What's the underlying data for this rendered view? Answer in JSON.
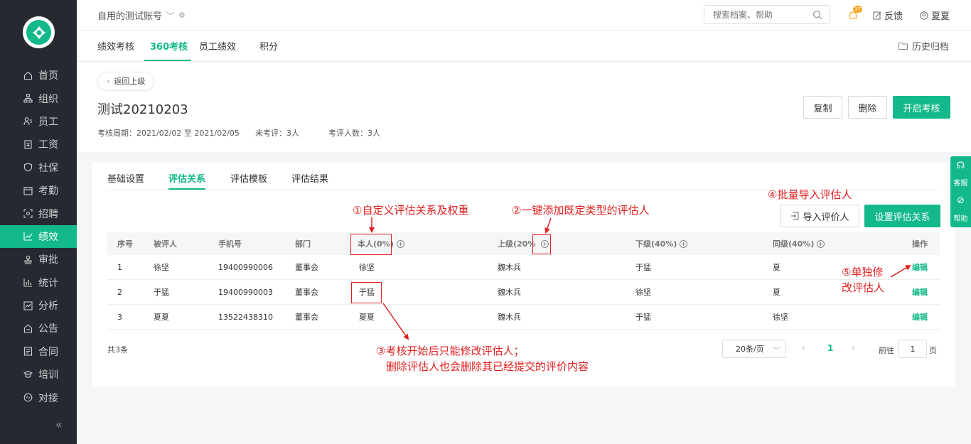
{
  "sidebar": {
    "items": [
      {
        "label": "首页",
        "icon": "home-icon"
      },
      {
        "label": "组织",
        "icon": "org-icon"
      },
      {
        "label": "员工",
        "icon": "employee-icon"
      },
      {
        "label": "工资",
        "icon": "salary-icon"
      },
      {
        "label": "社保",
        "icon": "shield-icon"
      },
      {
        "label": "考勤",
        "icon": "calendar-icon"
      },
      {
        "label": "招聘",
        "icon": "recruit-icon"
      },
      {
        "label": "绩效",
        "icon": "chart-icon"
      },
      {
        "label": "审批",
        "icon": "stamp-icon"
      },
      {
        "label": "统计",
        "icon": "stats-icon"
      },
      {
        "label": "分析",
        "icon": "analysis-icon"
      },
      {
        "label": "公告",
        "icon": "notice-icon"
      },
      {
        "label": "合同",
        "icon": "contract-icon"
      },
      {
        "label": "培训",
        "icon": "training-icon"
      },
      {
        "label": "对接",
        "icon": "link-icon"
      }
    ],
    "active": "绩效"
  },
  "topbar": {
    "account": "自用的测试账号",
    "search_placeholder": "搜索档案、帮助",
    "notify_badge": "37",
    "feedback": "反馈",
    "user": "夏夏"
  },
  "tabs": {
    "items": [
      "绩效考核",
      "360考核",
      "员工绩效",
      "积分"
    ],
    "active": "360考核",
    "archive": "历史归档"
  },
  "header": {
    "back": "返回上级",
    "title": "测试20210203",
    "period": "考核周期：2021/02/02 至 2021/02/05",
    "unrated": "未考评：3人",
    "rated": "考评人数：3人",
    "copy": "复制",
    "delete": "删除",
    "start": "开启考核"
  },
  "subtabs": {
    "items": [
      "基础设置",
      "评估关系",
      "评估模板",
      "评估结果"
    ],
    "active": "评估关系"
  },
  "actions": {
    "import": "导入评价人",
    "set_relation": "设置评估关系"
  },
  "table": {
    "columns": [
      "序号",
      "被评人",
      "手机号",
      "部门",
      "本人(0%)",
      "上级(20%",
      "下级(40%)",
      "同级(40%)",
      "操作"
    ],
    "rows": [
      [
        "1",
        "徐坚",
        "19400990006",
        "董事会",
        "徐坚",
        "魏木兵",
        "于猛",
        "夏",
        "编辑"
      ],
      [
        "2",
        "于猛",
        "19400990003",
        "董事会",
        "于猛",
        "魏木兵",
        "徐坚",
        "夏",
        "编辑"
      ],
      [
        "3",
        "夏夏",
        "13522438310",
        "董事会",
        "夏夏",
        "魏木兵",
        "于猛",
        "徐坚",
        "编辑"
      ]
    ]
  },
  "pagination": {
    "total": "共3条",
    "page_size": "20条/页",
    "prev": "‹",
    "current": "1",
    "next": "›",
    "goto_label": "前往",
    "goto_value": "1",
    "goto_suffix": "页"
  },
  "annotations": {
    "a1": "①自定义评估关系及权重",
    "a2": "②一键添加既定类型的评估人",
    "a3_line1": "③考核开始后只能修改评估人；",
    "a3_line2": "删除评估人也会删除其已经提交的评价内容",
    "a4": "④批量导入评估人",
    "a5_line1": "⑤单独修",
    "a5_line2": "改评估人"
  },
  "float": {
    "service": "客服",
    "help": "帮助"
  },
  "colors": {
    "brand": "#13b98a",
    "sidebar_bg": "#262a30",
    "annotation": "#e02020"
  }
}
